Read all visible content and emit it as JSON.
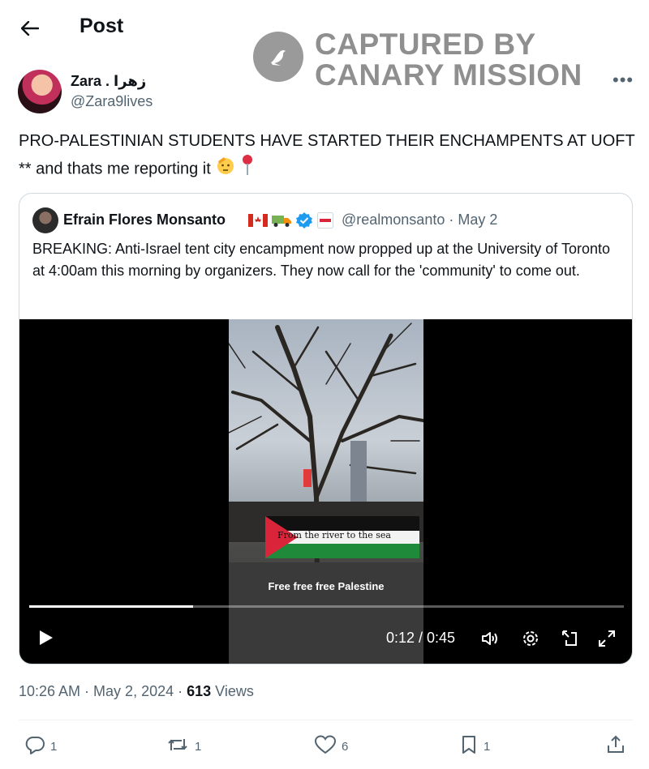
{
  "header": {
    "title": "Post"
  },
  "watermark": {
    "line1": "CAPTURED BY",
    "line2": "CANARY MISSION"
  },
  "author": {
    "name": "Zara . زهرا",
    "handle": "@Zara9lives"
  },
  "tweet": {
    "text": "PRO-PALESTINIAN STUDENTS HAVE STARTED THEIR ENCHAMPENTS AT UOFT ** and thats me reporting it"
  },
  "quote": {
    "name": "Efrain Flores Monsanto",
    "handle": "@realmonsanto",
    "date": "· May 2",
    "text": "BREAKING: Anti-Israel tent city encampment now propped up at the University of Toronto at 4:00am this morning by organizers. They now call for the 'community' to come out."
  },
  "video": {
    "caption": "Free free free Palestine",
    "banner_text": "From the river to the sea",
    "time": "0:12 / 0:45",
    "progress": 0.275
  },
  "meta": {
    "time": "10:26 AM · May 2, 2024 · ",
    "views_count": "613",
    "views_label": " Views"
  },
  "actions": {
    "replies": "1",
    "reposts": "1",
    "likes": "6",
    "bookmarks": "1"
  },
  "colors": {
    "text": "#0f1419",
    "secondary": "#536471",
    "verified": "#1d9bf0",
    "border": "#cfd9de"
  }
}
